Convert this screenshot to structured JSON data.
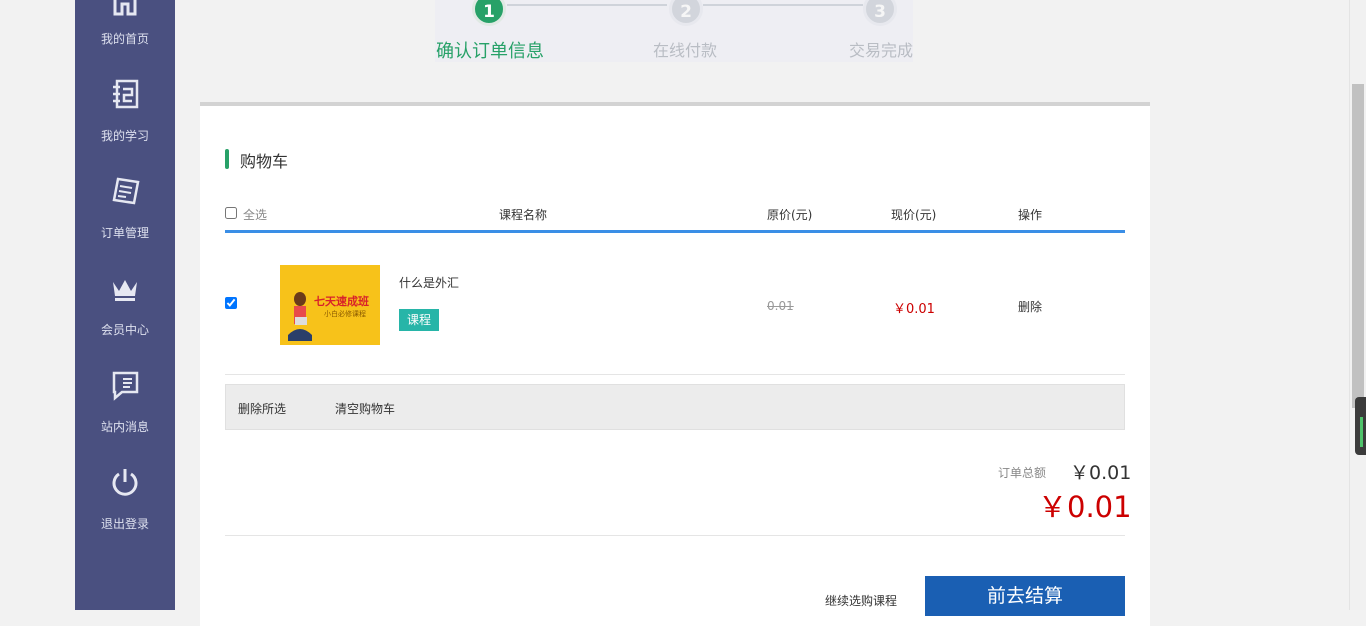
{
  "sidebar": {
    "items": [
      {
        "label": "我的首页",
        "icon": "home-icon"
      },
      {
        "label": "我的学习",
        "icon": "notebook-icon"
      },
      {
        "label": "订单管理",
        "icon": "order-icon"
      },
      {
        "label": "会员中心",
        "icon": "crown-icon"
      },
      {
        "label": "站内消息",
        "icon": "message-icon"
      },
      {
        "label": "退出登录",
        "icon": "power-icon"
      }
    ]
  },
  "steps": [
    {
      "num": "1",
      "label": "确认订单信息",
      "active": true
    },
    {
      "num": "2",
      "label": "在线付款",
      "active": false
    },
    {
      "num": "3",
      "label": "交易完成",
      "active": false
    }
  ],
  "cart": {
    "title": "购物车",
    "headers": {
      "select_all": "全选",
      "name": "课程名称",
      "original_price": "原价(元)",
      "current_price": "现价(元)",
      "operation": "操作"
    },
    "items": [
      {
        "thumb_title": "七天速成班",
        "thumb_sub": "小白必修课程",
        "name": "什么是外汇",
        "tag": "课程",
        "original_price": "0.01",
        "current_price": "￥0.01",
        "delete": "删除",
        "checked": true
      }
    ],
    "actions": {
      "delete_selected": "删除所选",
      "clear_cart": "清空购物车"
    },
    "summary": {
      "total_label": "订单总额",
      "total_value": "￥0.01",
      "pay_value": "￥0.01"
    },
    "footer": {
      "continue": "继续选购课程",
      "checkout": "前去结算"
    }
  },
  "colors": {
    "sidebar": "#4a5080",
    "accent_green": "#27a168",
    "header_line": "#3a8ee6",
    "price_red": "#cc0000",
    "checkout_button": "#1a5fb3"
  }
}
